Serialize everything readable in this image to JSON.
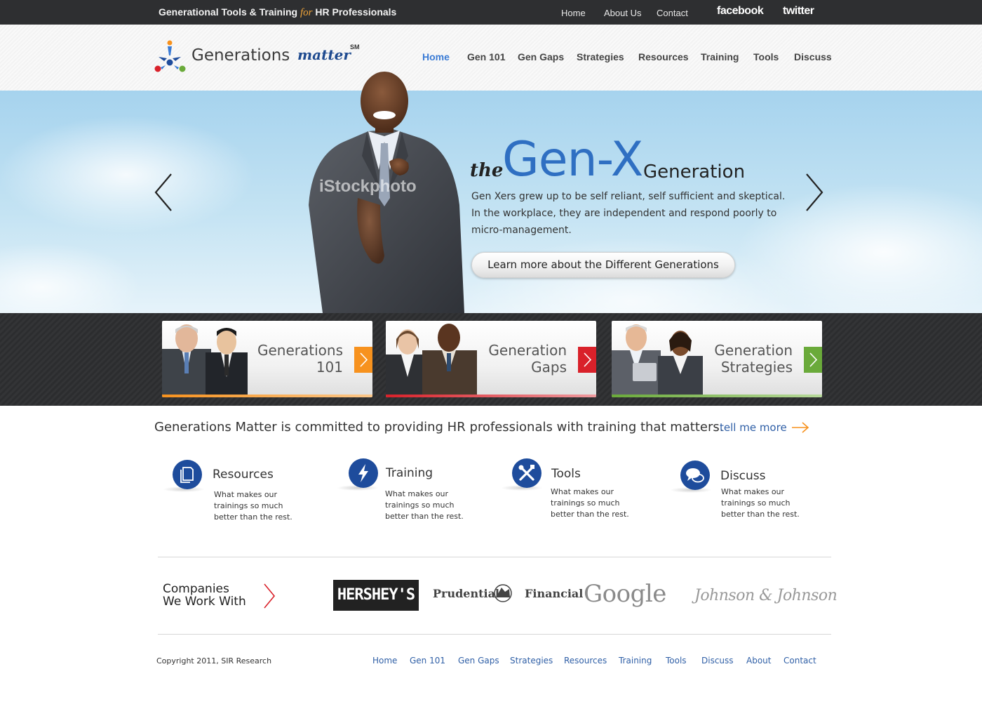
{
  "topbar": {
    "tagline_pre": "Generational Tools & Training ",
    "tagline_for": "for",
    "tagline_post": " HR Professionals",
    "links": [
      "Home",
      "About Us",
      "Contact"
    ],
    "social": [
      "facebook",
      "twitter"
    ]
  },
  "header": {
    "logo_text": "Generations",
    "logo_script": "matter",
    "logo_mark": "SM",
    "nav": [
      "Home",
      "Gen 101",
      "Gen Gaps",
      "Strategies",
      "Resources",
      "Training",
      "Tools",
      "Discuss"
    ],
    "active_nav": "Home"
  },
  "hero": {
    "the": "the",
    "headline": "Gen-X",
    "generation": "Generation",
    "description": "Gen Xers grew up to be self reliant, self sufficient and skeptical. In the workplace, they are independent and respond poorly to micro-management.",
    "cta": "Learn more about the Different Generations",
    "watermark": "iStockphoto"
  },
  "cards": [
    {
      "line1": "Generations",
      "line2": "101",
      "accent": "#f7921e"
    },
    {
      "line1": "Generation",
      "line2": "Gaps",
      "accent": "#d9212a"
    },
    {
      "line1": "Generation",
      "line2": "Strategies",
      "accent": "#6aaa3a"
    }
  ],
  "intro": {
    "text": "Generations Matter is committed to providing HR professionals with training that matters.",
    "link": "tell me more"
  },
  "features": [
    {
      "title": "Resources",
      "desc": "What makes our trainings so much better than the rest.",
      "icon": "document-icon"
    },
    {
      "title": "Training",
      "desc": "What makes our trainings so much better than the rest.",
      "icon": "lightning-icon"
    },
    {
      "title": "Tools",
      "desc": "What makes our trainings so much better than the rest.",
      "icon": "tools-icon"
    },
    {
      "title": "Discuss",
      "desc": "What makes our trainings so much better than the rest.",
      "icon": "chat-bubbles-icon"
    }
  ],
  "companies": {
    "line1": "Companies",
    "line2": "We Work With",
    "logos": [
      "HERSHEY'S",
      "Prudential",
      "Financial",
      "Google",
      "Johnson & Johnson"
    ]
  },
  "footer": {
    "copyright": "Copyright 2011, SIR Research",
    "links": [
      "Home",
      "Gen 101",
      "Gen Gaps",
      "Strategies",
      "Resources",
      "Training",
      "Tools",
      "Discuss",
      "About",
      "Contact"
    ]
  },
  "colors": {
    "accent_blue": "#3a7bd5",
    "icon_blue": "#1e4c9c",
    "link_blue": "#2f5fa6",
    "topbar": "#2e2f31",
    "orange": "#f7921e",
    "red": "#d9212a",
    "green": "#6aaa3a"
  }
}
